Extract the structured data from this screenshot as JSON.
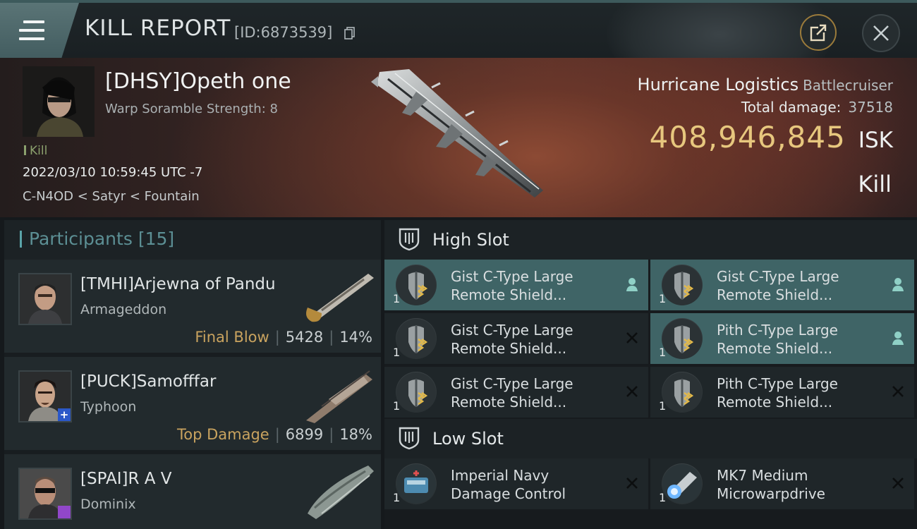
{
  "header": {
    "title": "KILL REPORT",
    "report_id": "[ID:6873539]"
  },
  "victim": {
    "name": "[DHSY]Opeth one",
    "subtitle": "Warp Soramble Strength: 8",
    "tag": "Kill",
    "datetime": "2022/03/10 10:59:45 UTC -7",
    "location": "C-N4OD < Satyr < Fountain",
    "ship_name": "Hurricane Logistics",
    "ship_class": "Battlecruiser",
    "damage_label": "Total damage:",
    "total_damage": "37518",
    "isk_value": "408,946,845",
    "isk_unit": "ISK",
    "result": "Kill"
  },
  "participants": {
    "label": "Participants",
    "count": "[15]",
    "items": [
      {
        "name": "[TMHI]Arjewna of Pandu",
        "ship": "Armageddon",
        "tag": "Final Blow",
        "damage": "5428",
        "percent": "14%"
      },
      {
        "name": "[PUCK]Samofffar",
        "ship": "Typhoon",
        "tag": "Top Damage",
        "damage": "6899",
        "percent": "18%"
      },
      {
        "name": "[SPAI]R A V",
        "ship": "Dominix",
        "tag": "",
        "damage": "",
        "percent": ""
      }
    ]
  },
  "fitting": {
    "high_slot_label": "High Slot",
    "low_slot_label": "Low Slot",
    "high_slots": [
      {
        "qty": "1",
        "line1": "Gist C-Type Large",
        "line2": "Remote Shield...",
        "status": "person-icon"
      },
      {
        "qty": "1",
        "line1": "Gist C-Type Large",
        "line2": "Remote Shield...",
        "status": "person-icon"
      },
      {
        "qty": "1",
        "line1": "Gist C-Type Large",
        "line2": "Remote Shield...",
        "status": "close-icon"
      },
      {
        "qty": "1",
        "line1": "Pith C-Type Large",
        "line2": "Remote Shield...",
        "status": "person-icon"
      },
      {
        "qty": "1",
        "line1": "Gist C-Type Large",
        "line2": "Remote Shield...",
        "status": "close-icon"
      },
      {
        "qty": "1",
        "line1": "Pith C-Type Large",
        "line2": "Remote Shield...",
        "status": "close-icon"
      }
    ],
    "low_slots": [
      {
        "qty": "1",
        "line1": "Imperial Navy",
        "line2": "Damage Control",
        "status": "close-icon"
      },
      {
        "qty": "1",
        "line1": "MK7 Medium",
        "line2": "Microwarpdrive",
        "status": "close-icon"
      }
    ]
  },
  "colors": {
    "accent_teal": "#3f6466",
    "isk_gold": "#e7c77e",
    "tag_gold": "#c9a35f",
    "kill_green": "#8ba06d"
  }
}
